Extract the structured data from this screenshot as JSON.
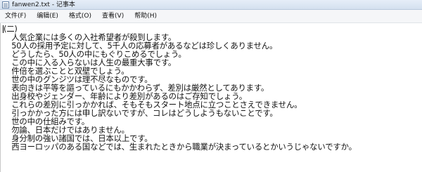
{
  "window": {
    "title": "fanwen2.txt - 记事本"
  },
  "menu": [
    {
      "label": "文件(F)"
    },
    {
      "label": "编辑(E)"
    },
    {
      "label": "格式(O)"
    },
    {
      "label": "查看(V)"
    },
    {
      "label": "帮助(H)"
    }
  ],
  "document": {
    "lines": [
      "(二)",
      "　人気企業には多くの入社希望者が殺到します。",
      "　50人の採用予定に対して、5千人の応募者があるなどは珍しくありません。",
      "　どうしたら、50人の中にもぐりこめるでしょう。",
      "　この中に入る入らないは人生の最重大事です。",
      "　件倍を選ぶことと双壁でしょう。",
      "　世の中のグンジツは理不尽なものです。",
      "　表向きは平等を謳っているにもかかわらず、差別は厳然としてあります。",
      "　出身校やジェンダー、年齢により差別があるのはご存知でしょう。",
      "　これらの差別に引っかかれば、そもそもスタート地点に立つことさえできません。",
      "　引っかかった方には申し訳ないですが、コレはどうしようもないことです。",
      "　世の中の仕組みです。",
      "　勿論、日本だけではありません。",
      "　身分制の強い諸国では、日本以上です。",
      "　西ヨーロッパのある国などでは、生まれたときから職業が決まっているとかいうじゃないですか。"
    ]
  }
}
